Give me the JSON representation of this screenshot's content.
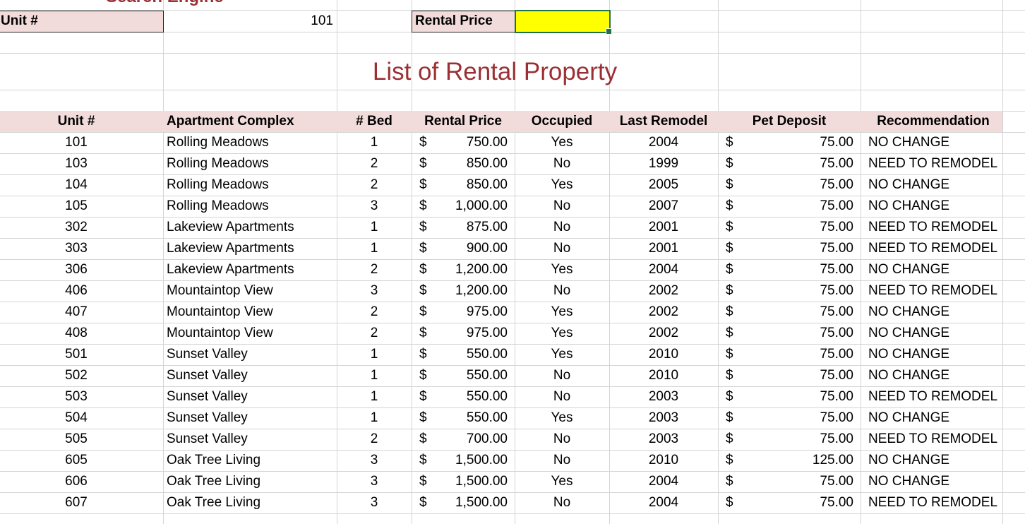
{
  "search": {
    "cutoff_title": "Search Engine",
    "unit_label": "Unit #",
    "unit_value": "101",
    "price_label": "Rental Price",
    "price_value": ""
  },
  "list_title": "List of Rental Property",
  "columns": [
    "Unit #",
    "Apartment Complex",
    "# Bed",
    "Rental Price",
    "Occupied",
    "Last Remodel",
    "Pet Deposit",
    "Recommendation"
  ],
  "currency_symbol": "$",
  "rows": [
    {
      "unit": "101",
      "complex": "Rolling Meadows",
      "bed": "1",
      "price": "750.00",
      "occupied": "Yes",
      "remodel": "2004",
      "deposit": "75.00",
      "rec": "NO CHANGE"
    },
    {
      "unit": "103",
      "complex": "Rolling Meadows",
      "bed": "2",
      "price": "850.00",
      "occupied": "No",
      "remodel": "1999",
      "deposit": "75.00",
      "rec": "NEED TO REMODEL"
    },
    {
      "unit": "104",
      "complex": "Rolling Meadows",
      "bed": "2",
      "price": "850.00",
      "occupied": "Yes",
      "remodel": "2005",
      "deposit": "75.00",
      "rec": "NO CHANGE"
    },
    {
      "unit": "105",
      "complex": "Rolling Meadows",
      "bed": "3",
      "price": "1,000.00",
      "occupied": "No",
      "remodel": "2007",
      "deposit": "75.00",
      "rec": "NO CHANGE"
    },
    {
      "unit": "302",
      "complex": "Lakeview Apartments",
      "bed": "1",
      "price": "875.00",
      "occupied": "No",
      "remodel": "2001",
      "deposit": "75.00",
      "rec": "NEED TO REMODEL"
    },
    {
      "unit": "303",
      "complex": "Lakeview Apartments",
      "bed": "1",
      "price": "900.00",
      "occupied": "No",
      "remodel": "2001",
      "deposit": "75.00",
      "rec": "NEED TO REMODEL"
    },
    {
      "unit": "306",
      "complex": "Lakeview Apartments",
      "bed": "2",
      "price": "1,200.00",
      "occupied": "Yes",
      "remodel": "2004",
      "deposit": "75.00",
      "rec": "NO CHANGE"
    },
    {
      "unit": "406",
      "complex": "Mountaintop View",
      "bed": "3",
      "price": "1,200.00",
      "occupied": "No",
      "remodel": "2002",
      "deposit": "75.00",
      "rec": "NEED TO REMODEL"
    },
    {
      "unit": "407",
      "complex": "Mountaintop View",
      "bed": "2",
      "price": "975.00",
      "occupied": "Yes",
      "remodel": "2002",
      "deposit": "75.00",
      "rec": "NO CHANGE"
    },
    {
      "unit": "408",
      "complex": "Mountaintop View",
      "bed": "2",
      "price": "975.00",
      "occupied": "Yes",
      "remodel": "2002",
      "deposit": "75.00",
      "rec": "NO CHANGE"
    },
    {
      "unit": "501",
      "complex": "Sunset Valley",
      "bed": "1",
      "price": "550.00",
      "occupied": "Yes",
      "remodel": "2010",
      "deposit": "75.00",
      "rec": "NO CHANGE"
    },
    {
      "unit": "502",
      "complex": "Sunset Valley",
      "bed": "1",
      "price": "550.00",
      "occupied": "No",
      "remodel": "2010",
      "deposit": "75.00",
      "rec": "NO CHANGE"
    },
    {
      "unit": "503",
      "complex": "Sunset Valley",
      "bed": "1",
      "price": "550.00",
      "occupied": "No",
      "remodel": "2003",
      "deposit": "75.00",
      "rec": "NEED TO REMODEL"
    },
    {
      "unit": "504",
      "complex": "Sunset Valley",
      "bed": "1",
      "price": "550.00",
      "occupied": "Yes",
      "remodel": "2003",
      "deposit": "75.00",
      "rec": "NO CHANGE"
    },
    {
      "unit": "505",
      "complex": "Sunset Valley",
      "bed": "2",
      "price": "700.00",
      "occupied": "No",
      "remodel": "2003",
      "deposit": "75.00",
      "rec": "NEED TO REMODEL"
    },
    {
      "unit": "605",
      "complex": "Oak Tree Living",
      "bed": "3",
      "price": "1,500.00",
      "occupied": "No",
      "remodel": "2010",
      "deposit": "125.00",
      "rec": "NO CHANGE"
    },
    {
      "unit": "606",
      "complex": "Oak Tree Living",
      "bed": "3",
      "price": "1,500.00",
      "occupied": "Yes",
      "remodel": "2004",
      "deposit": "75.00",
      "rec": "NO CHANGE"
    },
    {
      "unit": "607",
      "complex": "Oak Tree Living",
      "bed": "3",
      "price": "1,500.00",
      "occupied": "No",
      "remodel": "2004",
      "deposit": "75.00",
      "rec": "NEED TO REMODEL"
    }
  ],
  "colors": {
    "header_fill": "#f2dcdb",
    "title_color": "#9b3034",
    "selected_fill": "#ffff00",
    "selection_border": "#217346",
    "gridline": "#d4d4d4"
  }
}
